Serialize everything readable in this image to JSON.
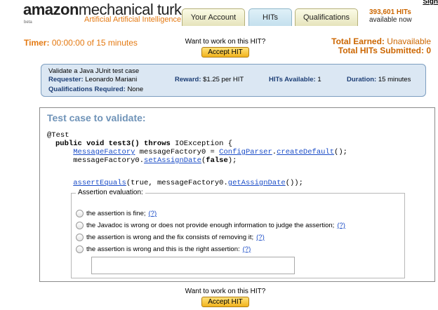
{
  "header": {
    "logo_brand": "amazon",
    "logo_product": "mechanical turk",
    "logo_tagline": "Artificial Artificial Intelligence",
    "logo_beta": "beta",
    "tabs": [
      {
        "label": "Your Account"
      },
      {
        "label": "HITs"
      },
      {
        "label": "Qualifications"
      }
    ],
    "hits_count": "393,601 HITs",
    "hits_sub": "available now",
    "sign_in": "Sign"
  },
  "timer": {
    "label": "Timer:",
    "value": "00:00:00 of 15 minutes"
  },
  "accept_top": {
    "prompt": "Want to work on this HIT?",
    "button": "Accept HIT"
  },
  "totals": {
    "earned_label": "Total Earned:",
    "earned_value": "Unavailable",
    "submitted_label": "Total HITs Submitted:",
    "submitted_value": "0"
  },
  "hit": {
    "title": "Validate a Java JUnit test case",
    "requester_label": "Requester:",
    "requester": "Leonardo Mariani",
    "reward_label": "Reward:",
    "reward": "$1.25 per HIT",
    "available_label": "HITs Available:",
    "available": "1",
    "duration_label": "Duration:",
    "duration": "15 minutes",
    "quals_label": "Qualifications Required:",
    "quals": "None"
  },
  "task": {
    "title": "Test case to validate:",
    "annotation": "@Test",
    "line1": {
      "kw1": "public void",
      "name": " test3() ",
      "kw2": "throws",
      "rest": " IOException {"
    },
    "line2": {
      "indent": "    ",
      "type_link": "MessageFactory",
      "mid": " messageFactory0 = ",
      "class_link": "ConfigParser",
      "dot": ".",
      "method_link": "createDefault",
      "end": "();"
    },
    "line3": {
      "indent": "    ",
      "pre": "messageFactory0.",
      "method_link": "setAssignDate",
      "open": "(",
      "kw": "false",
      "end": ");"
    },
    "line4": {
      "indent": "    ",
      "assert_link": "assertEquals",
      "mid": "(true, messageFactory0.",
      "method_link": "getAssignDate",
      "end": "());"
    },
    "legend": "Assertion evaluation:",
    "options": [
      {
        "label": "the assertion is fine;",
        "help": "(?)"
      },
      {
        "label": "the Javadoc is wrong or does not provide enough information to judge the assertion;",
        "help": "(?)"
      },
      {
        "label": "the assertion is wrong and the fix consists of removing it;",
        "help": "(?)"
      },
      {
        "label": "the assertion is wrong and this is the right assertion:",
        "help": "(?)"
      }
    ],
    "answer_value": ""
  },
  "accept_bottom": {
    "prompt": "Want to work on this HIT?",
    "button": "Accept HIT"
  },
  "colors": {
    "brand_orange": "#e47911",
    "link_blue": "#1a4cc7",
    "panel_title": "#6f93b8",
    "hitbox_bg": "#dbe7f3"
  }
}
